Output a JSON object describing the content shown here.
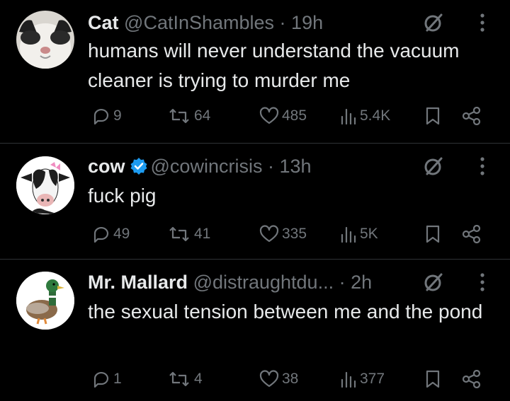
{
  "tweets": [
    {
      "name": "Cat",
      "handle": "@CatInShambles",
      "sep": " · ",
      "time": "19h",
      "verified": false,
      "text": "humans will never understand the vacuum cleaner is trying to murder me",
      "replies": "9",
      "reposts": "64",
      "likes": "485",
      "views": "5.4K"
    },
    {
      "name": "cow",
      "handle": "@cowincrisis",
      "sep": " · ",
      "time": "13h",
      "verified": true,
      "text": "fuck pig",
      "replies": "49",
      "reposts": "41",
      "likes": "335",
      "views": "5K"
    },
    {
      "name": "Mr. Mallard",
      "handle": "@distraughtdu...",
      "sep": " · ",
      "time": "2h",
      "verified": false,
      "text": "the sexual tension between me and the pond",
      "replies": "1",
      "reposts": "4",
      "likes": "38",
      "views": "377"
    }
  ],
  "colors": {
    "background": "#000000",
    "text": "#e7e9ea",
    "muted": "#71767b",
    "verified": "#1d9bf0",
    "divider": "#2f3336"
  },
  "icons": [
    "reply-icon",
    "repost-icon",
    "like-icon",
    "views-icon",
    "bookmark-icon",
    "share-icon",
    "grok-icon",
    "more-icon",
    "verified-icon"
  ]
}
